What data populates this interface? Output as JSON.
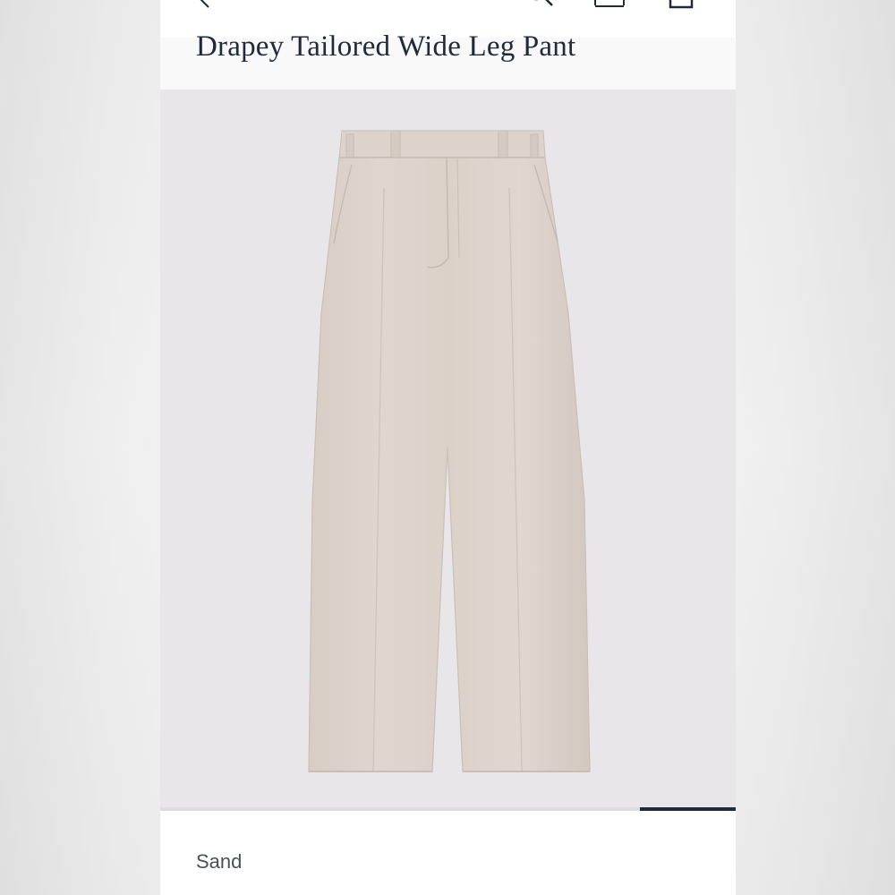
{
  "header": {
    "icons": [
      "back-icon",
      "search-icon",
      "account-icon",
      "bag-icon"
    ]
  },
  "product": {
    "title": "Drapey Tailored Wide Leg Pant",
    "image_alt": "Drapey Tailored Wide Leg Pant in Sand",
    "color_name": "Sand"
  },
  "gallery": {
    "progress": 0.167
  },
  "colors": {
    "navy": "#1f2a3b",
    "sand": "#ddd2ca",
    "image_bg": "#e8e6e8"
  }
}
